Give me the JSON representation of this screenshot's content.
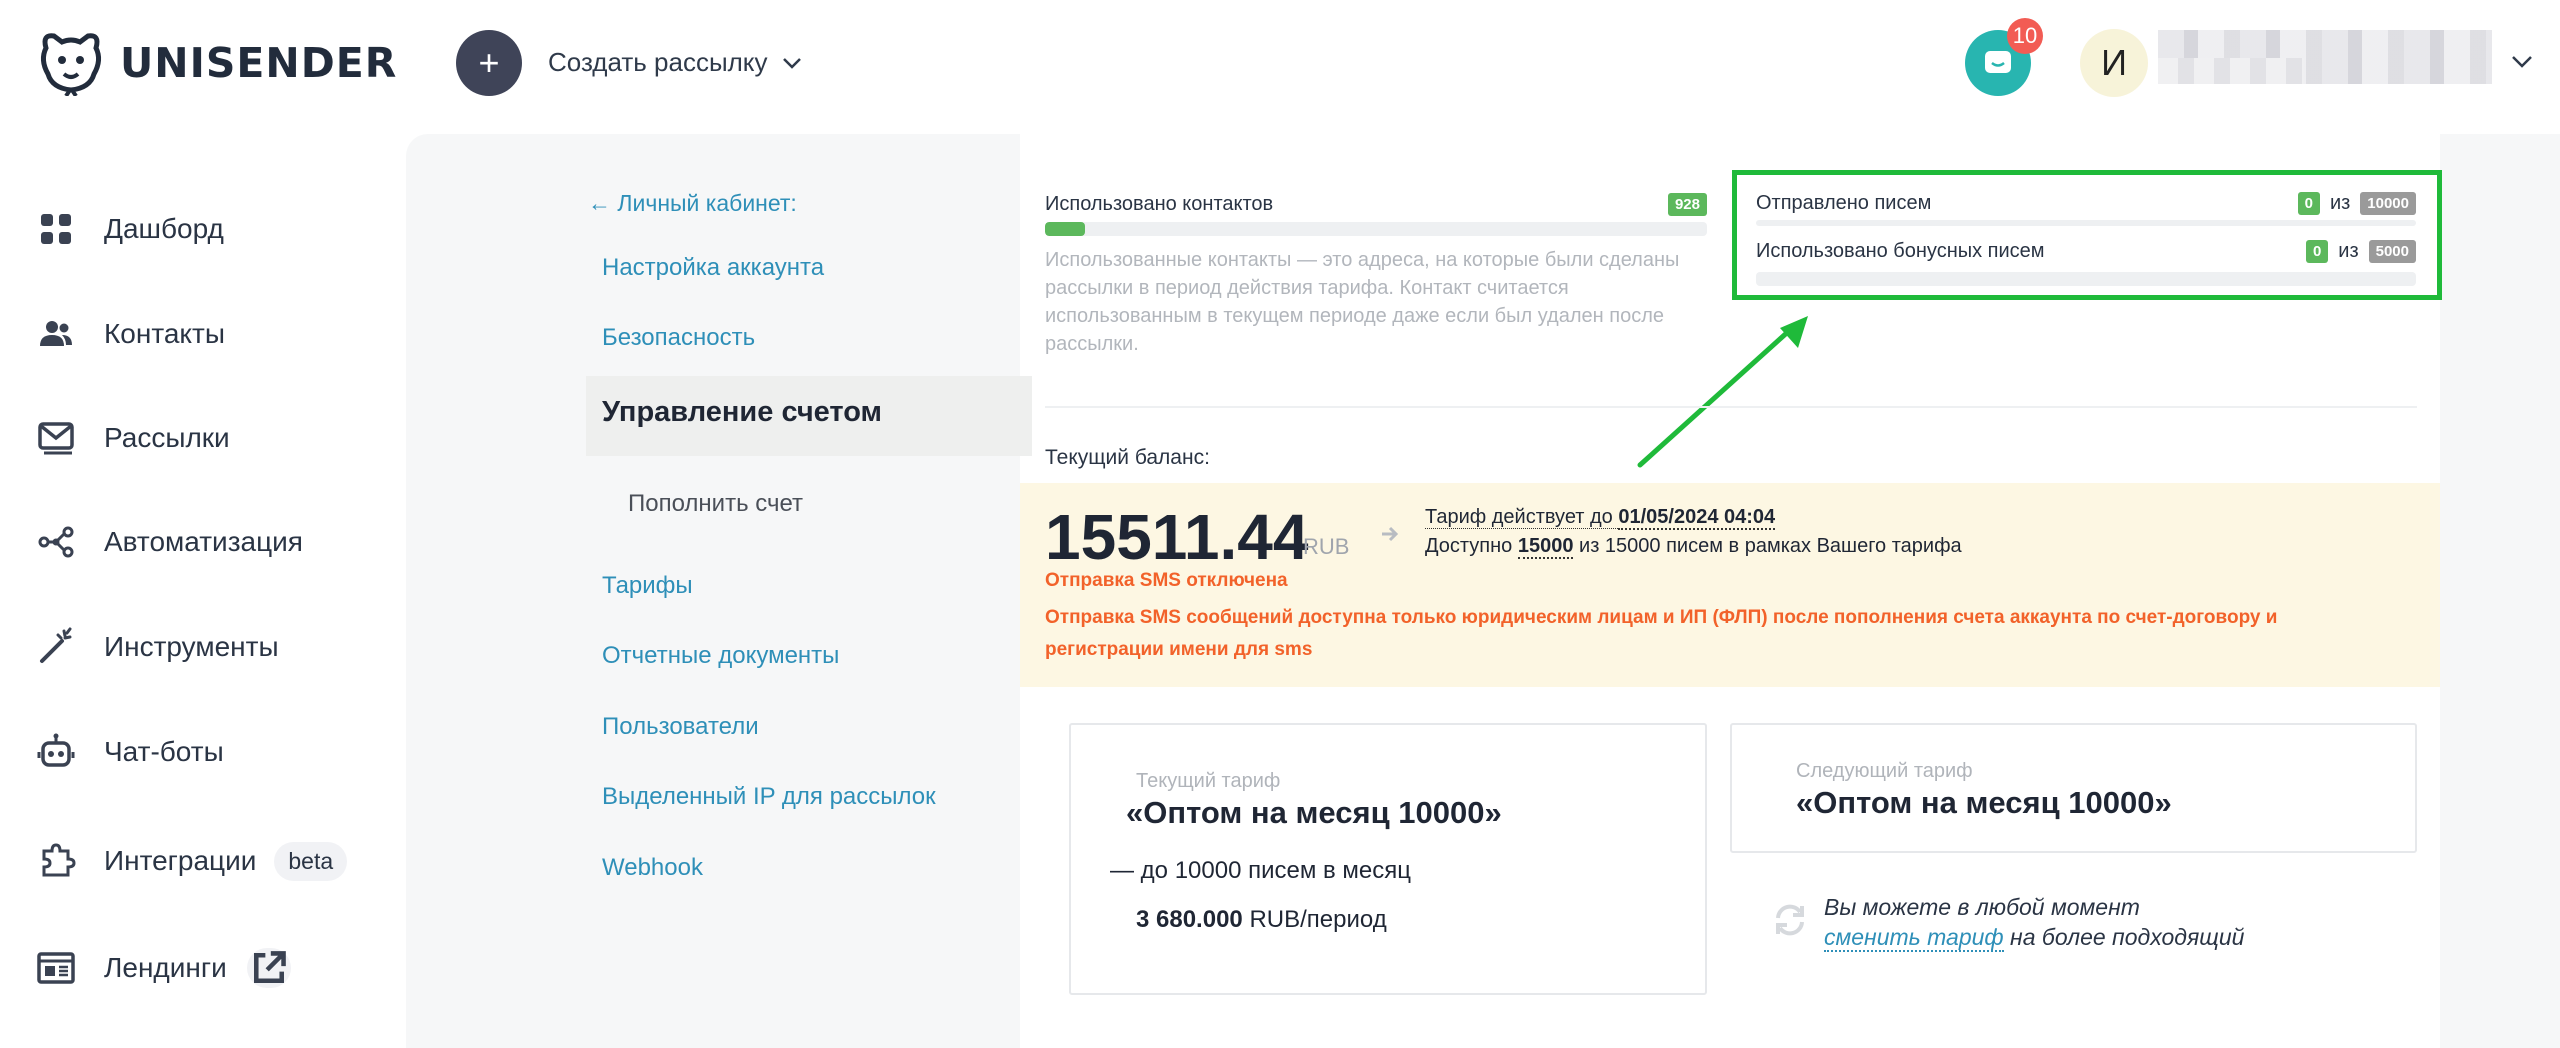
{
  "header": {
    "logo_text": "UNISENDER",
    "create_plus": "+",
    "create_label": "Создать рассылку",
    "chat_badge": "10",
    "avatar_letter": "И"
  },
  "sidebar": {
    "items": [
      {
        "label": "Дашборд",
        "icon": "dashboard-icon"
      },
      {
        "label": "Контакты",
        "icon": "contacts-icon"
      },
      {
        "label": "Рассылки",
        "icon": "mail-icon"
      },
      {
        "label": "Автоматизация",
        "icon": "automation-icon"
      },
      {
        "label": "Инструменты",
        "icon": "magic-wand-icon"
      },
      {
        "label": "Чат-боты",
        "icon": "robot-icon"
      },
      {
        "label": "Интеграции",
        "icon": "puzzle-icon",
        "badge": "beta"
      },
      {
        "label": "Лендинги",
        "icon": "landing-icon"
      }
    ]
  },
  "submenu": {
    "back": "← Личный кабинет:",
    "account_settings": "Настройка аккаунта",
    "security": "Безопасность",
    "billing": "Управление счетом",
    "top_up": "Пополнить счет",
    "tariffs": "Тарифы",
    "documents": "Отчетные документы",
    "users": "Пользователи",
    "dedicated_ip": "Выделенный IP для рассылок",
    "webhook": "Webhook"
  },
  "usage": {
    "contacts_label": "Использовано контактов",
    "contacts_count": "928",
    "contacts_fill_fraction": 0.06,
    "hint": "Использованные контакты — это адреса, на которые были сделаны рассылки в период действия тарифа. Контакт считается использованным в текущем периоде даже если был удален после рассылки.",
    "sent_label": "Отправлено писем",
    "sent_count": "0",
    "sent_of": "из",
    "sent_total": "10000",
    "bonus_label": "Использовано бонусных писем",
    "bonus_count": "0",
    "bonus_of": "из",
    "bonus_total": "5000"
  },
  "balance": {
    "label": "Текущий баланс:",
    "amount": "15511.44",
    "currency": "RUB",
    "tariff_until_prefix": "Тариф действует до ",
    "tariff_until_date": "01/05/2024 04:04",
    "available_prefix": "Доступно ",
    "available_count": "15000",
    "available_suffix": " из 15000 писем в рамках Вашего тарифа",
    "sms_off": "Отправка SMS отключена",
    "sms_warning": "Отправка SMS сообщений доступна только юридическим лицам и ИП (ФЛП) после пополнения счета аккаунта по счет-договору и регистрации имени для sms"
  },
  "current_tariff": {
    "label": "Текущий тариф",
    "name": "«Оптом на месяц 10000»",
    "limit": "— до 10000 писем в месяц",
    "price": "3 680.000",
    "price_unit": " RUB/период"
  },
  "next_tariff": {
    "label": "Следующий тариф",
    "name": "«Оптом на месяц 10000»"
  },
  "change": {
    "line1": "Вы можете в любой момент",
    "link": "сменить тариф",
    "line2_suffix": " на более подходящий"
  },
  "colors": {
    "accent_link": "#2e8fb8",
    "highlight": "#1fba3a",
    "warning": "#f2622a",
    "chat": "#28b5b0",
    "badge": "#f25c54"
  }
}
